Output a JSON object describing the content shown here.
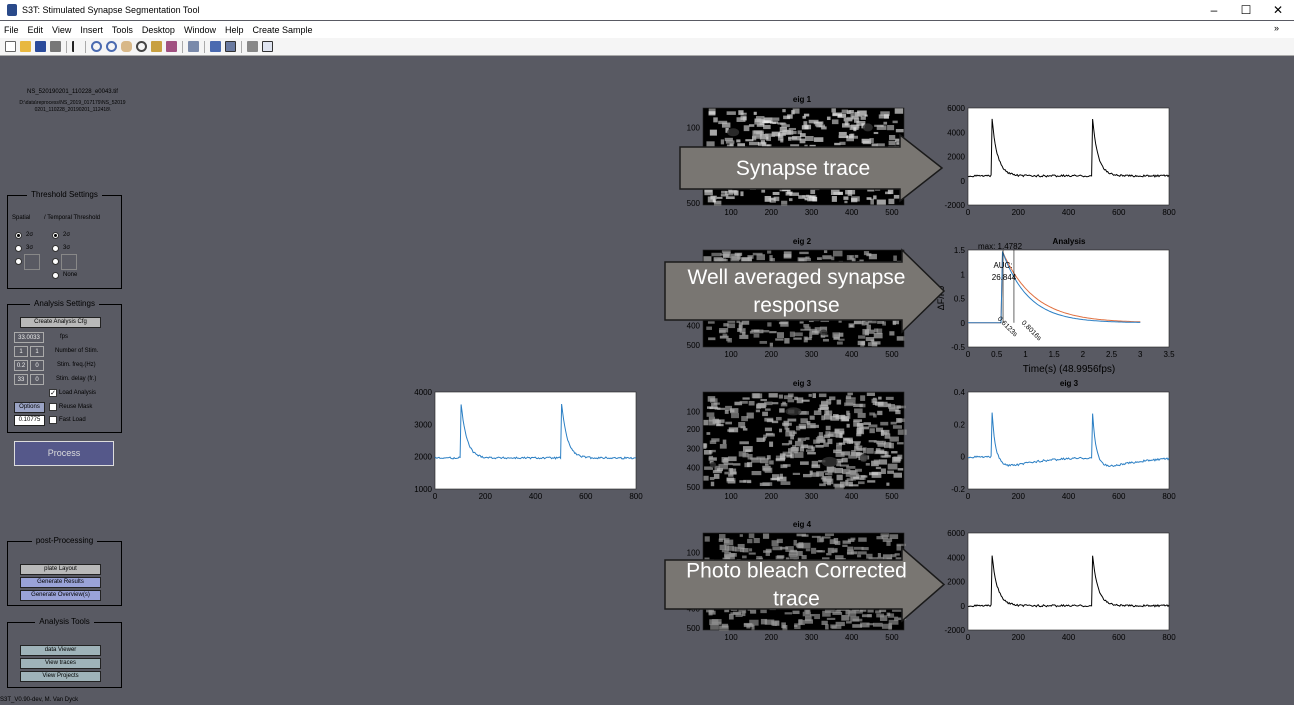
{
  "window": {
    "title": "S3T: Stimulated Synapse Segmentation Tool",
    "minimize": "–",
    "maximize": "☐",
    "close": "✕"
  },
  "menu": [
    "File",
    "Edit",
    "View",
    "Insert",
    "Tools",
    "Desktop",
    "Window",
    "Help",
    "Create Sample"
  ],
  "file": {
    "name": "NS_520190201_110228_e0043.tif",
    "path_line1": "D:\\data\\reprocess\\NS_2019_017179\\NS_52019",
    "path_line2": "0201_110228_20190201_112418\\"
  },
  "threshold": {
    "title": "Threshold Settings",
    "col1": "Spatial",
    "col2": "/ Temporal Threshold",
    "opt1": "2σ",
    "opt2": "3σ",
    "none": "None"
  },
  "analysis": {
    "title": "Analysis Settings",
    "create_cfg": "Create Analysis Cfg",
    "fps_value": "33.0033",
    "fps_label": "fps",
    "nstim_label": "Number of Stim.",
    "nstim_a": "1",
    "nstim_b": "1",
    "freq_label": "Stim. freq.(Hz)",
    "freq_a": "0.2",
    "freq_b": "0",
    "delay_label": "Stim. delay (fr.)",
    "delay_a": "33",
    "delay_b": "0",
    "load_analysis": "Load Analysis",
    "options": "Options",
    "reuse_mask": "Reuse Mask",
    "value": "0.10775",
    "fast_load": "Fast Load",
    "process": "Process"
  },
  "post": {
    "title": "post-Processing",
    "plate_layout": "plate Layout",
    "generate_results": "Generate Results",
    "generate_overview": "Generate Overview(s)"
  },
  "tools": {
    "title": "Analysis Tools",
    "data_viewer": "data Viewer",
    "view_traces": "View traces",
    "view_projects": "View Projects"
  },
  "version": "S3T_V0.90-dev, M. Van Dyck",
  "eig_titles": [
    "eig 1",
    "eig 2",
    "eig 3",
    "eig 4"
  ],
  "analysis_plot": {
    "title": "Analysis",
    "max": "max: 1.4782",
    "auc_label": "AUC:",
    "auc_value": "26.844",
    "t1": "0.6123s",
    "t2": "0.8016s",
    "xlabel": "Time(s) (48.9956fps)",
    "ylabel": "ΔF/F0",
    "x_ticks": [
      "0",
      "0.5",
      "1",
      "1.5",
      "2",
      "2.5",
      "3",
      "3.5"
    ],
    "y_ticks": [
      "1.5",
      "1",
      "0.5",
      "0",
      "-0.5"
    ]
  },
  "right_eig3_title": "eig 3",
  "annotations": {
    "arrow1": "Synapse trace",
    "arrow2_line1": "Well averaged synapse",
    "arrow2_line2": "response",
    "arrow3_line1": "Photo bleach Corrected",
    "arrow3_line2": "trace"
  },
  "ticks": {
    "img_x": [
      "100",
      "200",
      "300",
      "400",
      "500"
    ],
    "img_y_full": [
      "100",
      "200",
      "300",
      "400",
      "500"
    ],
    "img_y_short": [
      "100",
      "400",
      "500"
    ],
    "img_y_eig1": [
      "100",
      "500"
    ],
    "trace_x": [
      "0",
      "200",
      "400",
      "600",
      "800"
    ],
    "trace1_y": [
      "6000",
      "4000",
      "2000",
      "0",
      "-2000"
    ],
    "trace_left_y": [
      "4000",
      "3000",
      "2000",
      "1000"
    ],
    "trace_eig3_y": [
      "0.4",
      "0.2",
      "0",
      "-0.2"
    ],
    "trace4_y": [
      "6000",
      "4000",
      "2000",
      "0",
      "-2000"
    ]
  }
}
